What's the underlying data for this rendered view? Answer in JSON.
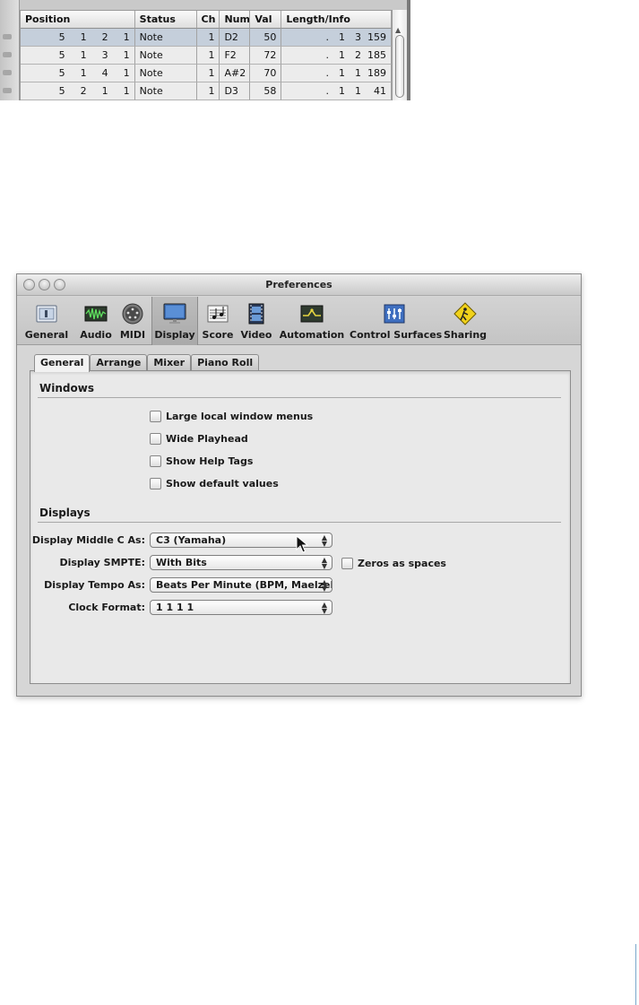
{
  "event_list": {
    "columns": [
      "Position",
      "Status",
      "Ch",
      "Num",
      "Val",
      "Length/Info"
    ],
    "rows": [
      {
        "pos": [
          "5",
          "1",
          "2",
          "1"
        ],
        "status": "Note",
        "ch": "1",
        "num": "D2",
        "val": "50",
        "len": [
          ".",
          "1",
          "3",
          "159"
        ],
        "selected": true
      },
      {
        "pos": [
          "5",
          "1",
          "3",
          "1"
        ],
        "status": "Note",
        "ch": "1",
        "num": "F2",
        "val": "72",
        "len": [
          ".",
          "1",
          "2",
          "185"
        ],
        "selected": false
      },
      {
        "pos": [
          "5",
          "1",
          "4",
          "1"
        ],
        "status": "Note",
        "ch": "1",
        "num": "A#2",
        "val": "70",
        "len": [
          ".",
          "1",
          "1",
          "189"
        ],
        "selected": false
      },
      {
        "pos": [
          "5",
          "2",
          "1",
          "1"
        ],
        "status": "Note",
        "ch": "1",
        "num": "D3",
        "val": "58",
        "len": [
          ".",
          "1",
          "1",
          "41"
        ],
        "selected": false
      }
    ]
  },
  "window": {
    "title": "Preferences",
    "toolbar": [
      {
        "label": "General",
        "icon": "general-icon"
      },
      {
        "label": "Audio",
        "icon": "audio-icon"
      },
      {
        "label": "MIDI",
        "icon": "midi-icon"
      },
      {
        "label": "Display",
        "icon": "display-icon",
        "active": true
      },
      {
        "label": "Score",
        "icon": "score-icon"
      },
      {
        "label": "Video",
        "icon": "video-icon"
      },
      {
        "label": "Automation",
        "icon": "automation-icon"
      },
      {
        "label": "Control Surfaces",
        "icon": "control-surfaces-icon"
      },
      {
        "label": "Sharing",
        "icon": "sharing-icon"
      }
    ],
    "tabs": [
      {
        "label": "General",
        "active": true
      },
      {
        "label": "Arrange"
      },
      {
        "label": "Mixer"
      },
      {
        "label": "Piano Roll"
      }
    ],
    "windows_section": {
      "title": "Windows",
      "checkboxes": [
        {
          "label": "Large local window menus",
          "checked": false
        },
        {
          "label": "Wide Playhead",
          "checked": false
        },
        {
          "label": "Show Help Tags",
          "checked": false
        },
        {
          "label": "Show default values",
          "checked": false
        }
      ]
    },
    "displays_section": {
      "title": "Displays",
      "middle_c": {
        "label": "Display Middle C As:",
        "value": "C3 (Yamaha)"
      },
      "smpte": {
        "label": "Display SMPTE:",
        "value": "With Bits",
        "extra_checkbox": "Zeros as spaces"
      },
      "tempo": {
        "label": "Display Tempo As:",
        "value": "Beats Per Minute (BPM, Maelzel)"
      },
      "clock": {
        "label": "Clock Format:",
        "value": "1 1 1 1"
      }
    }
  },
  "colors": {
    "selected_row": "#c5cfdb",
    "window_bg": "#d6d6d6",
    "panel_bg": "#e9e9e9",
    "page_margin_bar": "#7aa7cc"
  }
}
